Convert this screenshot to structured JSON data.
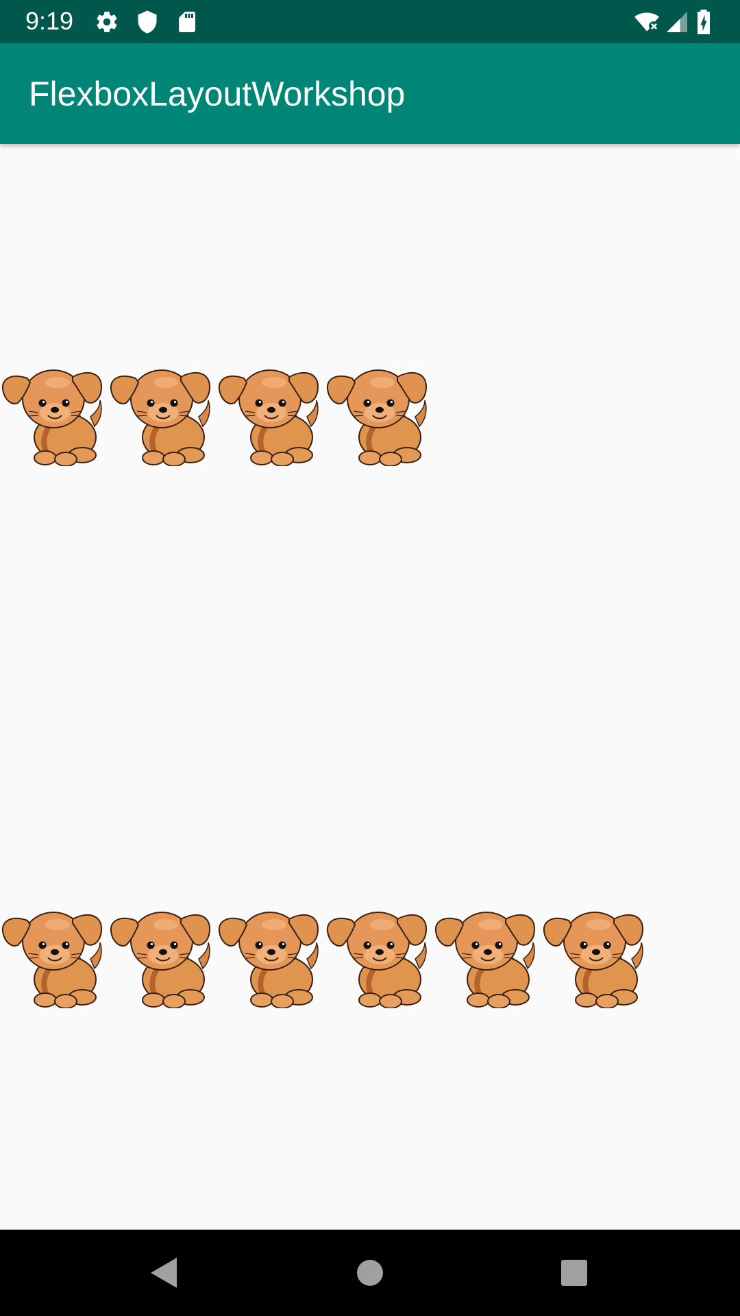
{
  "status_bar": {
    "time": "9:19",
    "left_icons": [
      "settings-icon",
      "shield-icon",
      "sd-card-icon"
    ],
    "right_icons": [
      "wifi-icon",
      "cell-signal-icon",
      "battery-charging-icon"
    ],
    "background": "#00574b"
  },
  "app_bar": {
    "title": "FlexboxLayoutWorkshop",
    "background": "#008577"
  },
  "content": {
    "rows": [
      {
        "name": "row-1",
        "item_count": 4,
        "item_icon": "puppy-icon"
      },
      {
        "name": "row-2",
        "item_count": 6,
        "item_icon": "puppy-icon"
      }
    ]
  },
  "nav_bar": {
    "buttons": [
      "back-icon",
      "home-icon",
      "recents-icon"
    ]
  }
}
